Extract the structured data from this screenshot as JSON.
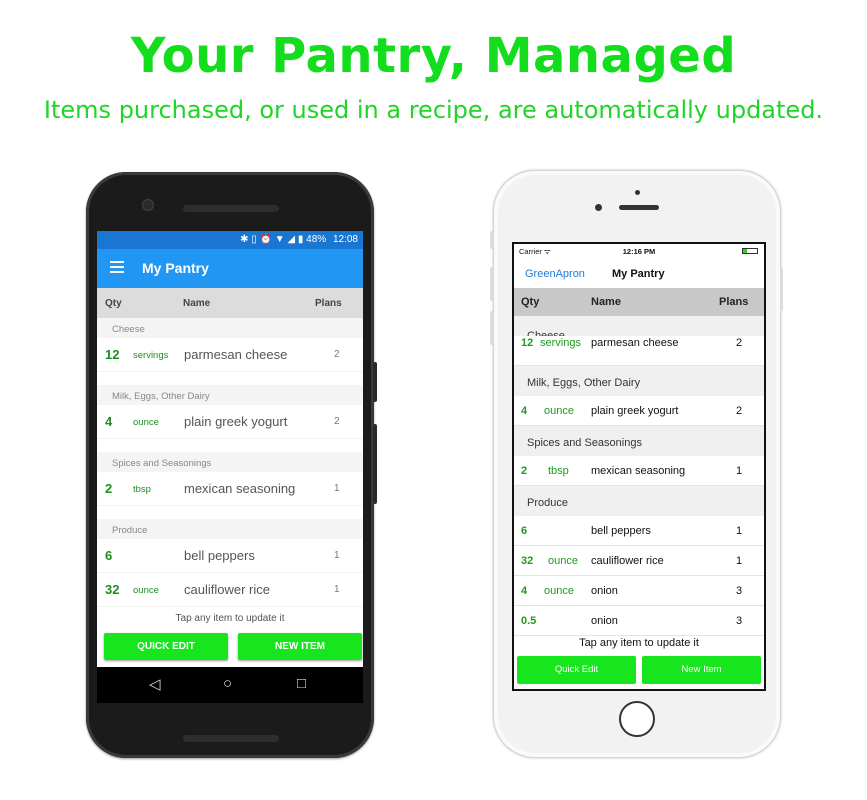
{
  "page": {
    "headline": "Your Pantry, Managed",
    "subline": "Items purchased, or used in a recipe, are automatically updated."
  },
  "colors": {
    "accent_green": "#13dd1d",
    "android_appbar": "#2196f3",
    "ios_link": "#1f7ae0"
  },
  "android": {
    "status": {
      "battery": "48%",
      "time": "12:08",
      "icons": "✱ ▯ ⏰ ▼ ◢ ▮"
    },
    "appbar": {
      "menu_icon": "hamburger-menu-icon",
      "title": "My Pantry"
    },
    "header": {
      "qty": "Qty",
      "name": "Name",
      "plans": "Plans"
    },
    "sections": [
      {
        "title": "Cheese"
      },
      {
        "title": "Milk, Eggs, Other Dairy"
      },
      {
        "title": "Spices and Seasonings"
      },
      {
        "title": "Produce"
      }
    ],
    "items": [
      {
        "qty": "12",
        "unit": "servings",
        "name": "parmesan cheese",
        "plans": "2"
      },
      {
        "qty": "4",
        "unit": "ounce",
        "name": "plain greek yogurt",
        "plans": "2"
      },
      {
        "qty": "2",
        "unit": "tbsp",
        "name": "mexican seasoning",
        "plans": "1"
      },
      {
        "qty": "6",
        "unit": "",
        "name": "bell peppers",
        "plans": "1"
      },
      {
        "qty": "32",
        "unit": "ounce",
        "name": "cauliflower rice",
        "plans": "1"
      }
    ],
    "tap_hint": "Tap any item to update it",
    "quick_edit": "QUICK EDIT",
    "new_item": "NEW ITEM",
    "nav": {
      "back": "◁",
      "home": "○",
      "recents": "□"
    }
  },
  "ios": {
    "status": {
      "carrier": "Carrier ᯤ",
      "time": "12:16 PM"
    },
    "nav": {
      "back": "GreenApron",
      "title": "My Pantry"
    },
    "header": {
      "qty": "Qty",
      "name": "Name",
      "plans": "Plans"
    },
    "sections": [
      {
        "title": "Cheese"
      },
      {
        "title": "Milk, Eggs, Other Dairy"
      },
      {
        "title": "Spices and Seasonings"
      },
      {
        "title": "Produce"
      }
    ],
    "items": [
      {
        "qty": "12",
        "unit": "servings",
        "name": "parmesan cheese",
        "plans": "2"
      },
      {
        "qty": "4",
        "unit": "ounce",
        "name": "plain greek yogurt",
        "plans": "2"
      },
      {
        "qty": "2",
        "unit": "tbsp",
        "name": "mexican seasoning",
        "plans": "1"
      },
      {
        "qty": "6",
        "unit": "",
        "name": "bell peppers",
        "plans": "1"
      },
      {
        "qty": "32",
        "unit": "ounce",
        "name": "cauliflower rice",
        "plans": "1"
      },
      {
        "qty": "4",
        "unit": "ounce",
        "name": "onion",
        "plans": "3"
      },
      {
        "qty": "0.5",
        "unit": "",
        "name": "onion",
        "plans": "3"
      }
    ],
    "tap_hint": "Tap any item to update it",
    "quick_edit": "Quick Edit",
    "new_item": "New Item"
  }
}
